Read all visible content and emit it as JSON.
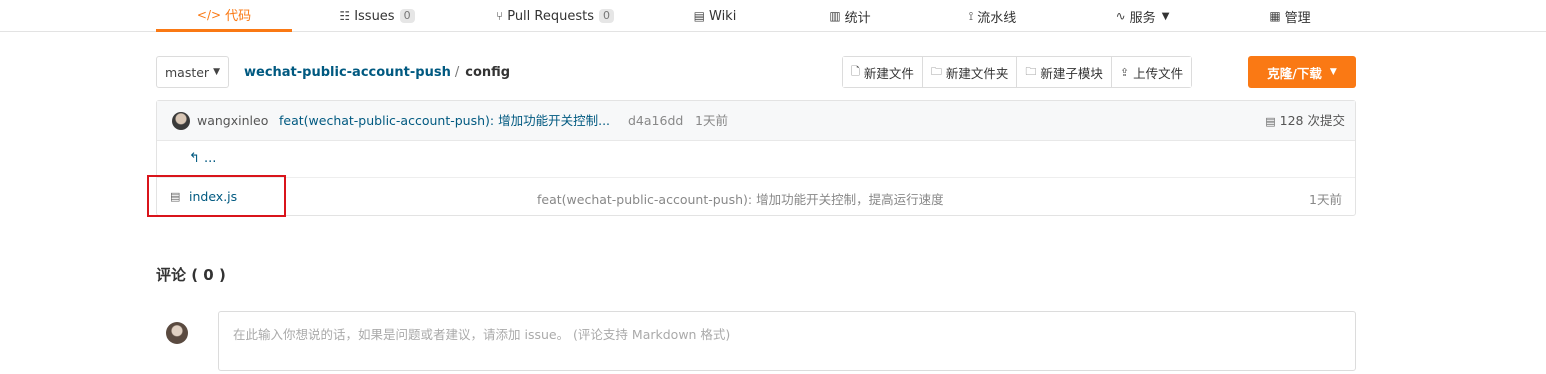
{
  "nav": {
    "tabs": [
      {
        "icon": "</>",
        "label": "代码"
      },
      {
        "icon": "☷",
        "label": "Issues",
        "count": "0"
      },
      {
        "icon": "⑂",
        "label": "Pull Requests",
        "count": "0"
      },
      {
        "icon": "▤",
        "label": "Wiki"
      },
      {
        "icon": "▥",
        "label": "统计"
      },
      {
        "icon": "⟟",
        "label": "流水线"
      },
      {
        "icon": "∿",
        "label": "服务"
      },
      {
        "icon": "▦",
        "label": "管理"
      }
    ]
  },
  "toolbar": {
    "branch": "master",
    "repo": "wechat-public-account-push",
    "separator": "/",
    "folder": "config",
    "buttons": [
      "新建文件",
      "新建文件夹",
      "新建子模块",
      "上传文件"
    ],
    "clone_label": "克隆/下载"
  },
  "commit": {
    "author": "wangxinleo",
    "message": "feat(wechat-public-account-push): 增加功能开关控制...",
    "sha": "d4a16dd",
    "time": "1天前",
    "count": "128 次提交"
  },
  "tree": {
    "up": "...",
    "files": [
      {
        "name": "index.js",
        "message": "feat(wechat-public-account-push): 增加功能开关控制，提高运行速度",
        "time": "1天前"
      }
    ]
  },
  "comments": {
    "title": "评论 ( 0 )",
    "placeholder": "在此输入你想说的话，如果是问题或者建议，请添加 issue。 (评论支持 Markdown 格式)"
  },
  "colors": {
    "accent": "#fa7914",
    "link": "#005980",
    "highlight_box": "#d9141b"
  }
}
